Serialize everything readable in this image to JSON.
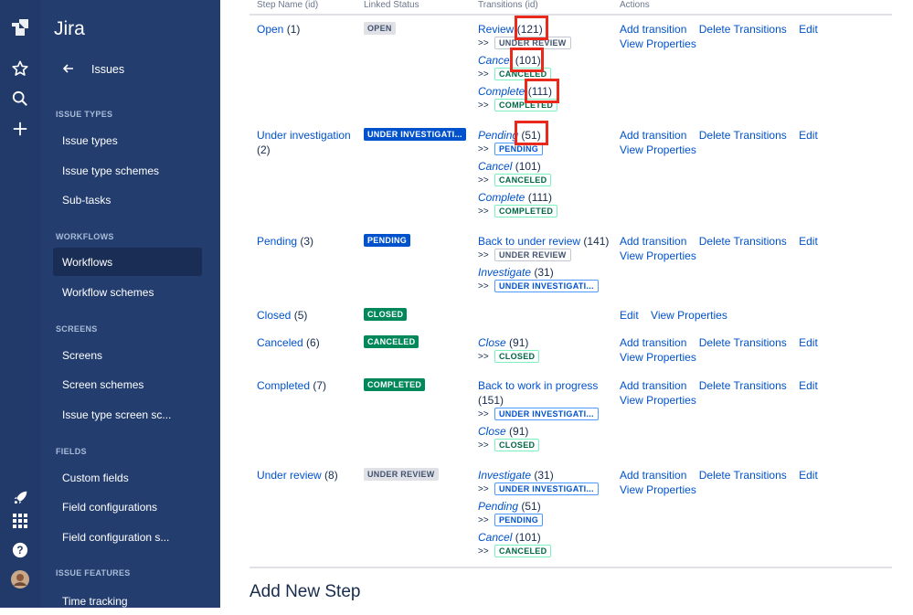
{
  "app": {
    "name": "Jira"
  },
  "rail": {
    "icons": [
      "jira-logo-icon",
      "star-icon",
      "search-icon",
      "plus-icon",
      "rocket-icon",
      "apps-grid-icon",
      "help-icon",
      "avatar"
    ]
  },
  "sidebar": {
    "back_label": "Issues",
    "sections": [
      {
        "title": "ISSUE TYPES",
        "items": [
          "Issue types",
          "Issue type schemes",
          "Sub-tasks"
        ]
      },
      {
        "title": "WORKFLOWS",
        "items": [
          "Workflows",
          "Workflow schemes"
        ]
      },
      {
        "title": "SCREENS",
        "items": [
          "Screens",
          "Screen schemes",
          "Issue type screen sc..."
        ]
      },
      {
        "title": "FIELDS",
        "items": [
          "Custom fields",
          "Field configurations",
          "Field configuration s..."
        ]
      },
      {
        "title": "ISSUE FEATURES",
        "items": [
          "Time tracking"
        ]
      }
    ],
    "selected": "Workflows"
  },
  "table": {
    "headers": [
      "Step Name (id)",
      "Linked Status",
      "Transitions (id)",
      "Actions"
    ],
    "rows": [
      {
        "step": "Open",
        "id": "(1)",
        "status": "OPEN",
        "transitions": [
          {
            "name": "Review",
            "id": "(121)",
            "target": "UNDER REVIEW"
          },
          {
            "name": "Cancel",
            "id": "(101)",
            "target": "CANCELED"
          },
          {
            "name": "Complete",
            "id": "(111)",
            "target": "COMPLETED"
          }
        ]
      },
      {
        "step": "Under investigation",
        "id": "(2)",
        "status": "UNDER INVESTIGATI...",
        "transitions": [
          {
            "name": "Pending",
            "id": "(51)",
            "target": "PENDING"
          },
          {
            "name": "Cancel",
            "id": "(101)",
            "target": "CANCELED"
          },
          {
            "name": "Complete",
            "id": "(111)",
            "target": "COMPLETED"
          }
        ]
      },
      {
        "step": "Pending",
        "id": "(3)",
        "status": "PENDING",
        "transitions": [
          {
            "name": "Back to under review",
            "id": "(141)",
            "target": "UNDER REVIEW"
          },
          {
            "name": "Investigate",
            "id": "(31)",
            "target": "UNDER INVESTIGATI..."
          }
        ]
      },
      {
        "step": "Closed",
        "id": "(5)",
        "status": "CLOSED",
        "transitions": []
      },
      {
        "step": "Canceled",
        "id": "(6)",
        "status": "CANCELED",
        "transitions": [
          {
            "name": "Close",
            "id": "(91)",
            "target": "CLOSED"
          }
        ]
      },
      {
        "step": "Completed",
        "id": "(7)",
        "status": "COMPLETED",
        "transitions": [
          {
            "name": "Back to work in progress",
            "id": "(151)",
            "target": "UNDER INVESTIGATI..."
          },
          {
            "name": "Close",
            "id": "(91)",
            "target": "CLOSED"
          }
        ]
      },
      {
        "step": "Under review",
        "id": "(8)",
        "status": "UNDER REVIEW",
        "transitions": [
          {
            "name": "Investigate",
            "id": "(31)",
            "target": "UNDER INVESTIGATI..."
          },
          {
            "name": "Pending",
            "id": "(51)",
            "target": "PENDING"
          },
          {
            "name": "Cancel",
            "id": "(101)",
            "target": "CANCELED"
          }
        ]
      }
    ],
    "actions": {
      "add": "Add transition",
      "delete": "Delete Transitions",
      "edit": "Edit",
      "view": "View Properties"
    },
    "arrow": ">>"
  },
  "add_new_step": "Add New Step",
  "colors": {
    "rail": "#213a69",
    "sidebar": "#233d6e",
    "link": "#0052cc",
    "highlight": "#e8291c"
  }
}
